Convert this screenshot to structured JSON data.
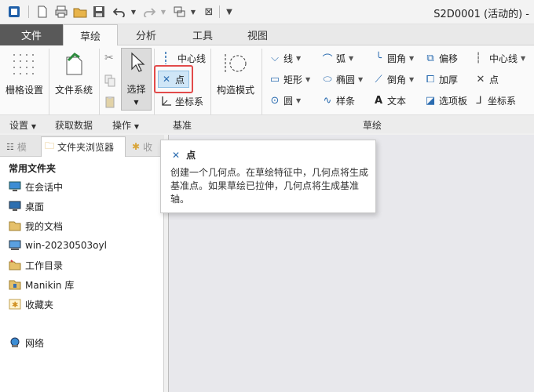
{
  "titlebar": {
    "title": "S2D0001 (活动的) -",
    "quick_access_icons": [
      "app-icon",
      "new-icon",
      "print-icon",
      "open-icon",
      "save-icon",
      "undo-icon",
      "redo-icon",
      "regenerate-icon",
      "close-window-icon",
      "customize-icon"
    ]
  },
  "tabs": [
    {
      "label": "文件"
    },
    {
      "label": "草绘"
    },
    {
      "label": "分析"
    },
    {
      "label": "工具"
    },
    {
      "label": "视图"
    }
  ],
  "ribbon": {
    "grid_settings": "栅格设置",
    "file_system": "文件系统",
    "select": "选择",
    "construction_mode": "构造模式",
    "datum": {
      "centerline": "中心线",
      "point": "点",
      "coordinate_system": "坐标系"
    },
    "sketch": {
      "line": "线",
      "arc": "弧",
      "fillet": "圆角",
      "offset": "偏移",
      "centerline": "中心线",
      "rectangle": "矩形",
      "ellipse": "椭圆",
      "chamfer": "倒角",
      "thicken": "加厚",
      "point": "点",
      "circle": "圆",
      "spline": "样条",
      "text": "文本",
      "palette": "选项板",
      "coordinate_system": "坐标系"
    },
    "groups": {
      "setup": "设置",
      "get_data": "获取数据",
      "operations": "操作",
      "datum": "基准",
      "sketch": "草绘"
    }
  },
  "left_panel": {
    "tabs": [
      "模型树",
      "文件夹浏览器",
      "收藏夹"
    ],
    "visible_tab_labels": [
      "模",
      "文件夹浏览器",
      "收"
    ],
    "header": "常用文件夹",
    "items": [
      {
        "label": "在会话中",
        "icon": "monitor-icon"
      },
      {
        "label": "桌面",
        "icon": "desktop-icon"
      },
      {
        "label": "我的文档",
        "icon": "documents-icon"
      },
      {
        "label": "win-20230503oyl",
        "icon": "computer-icon"
      },
      {
        "label": "工作目录",
        "icon": "working-directory-icon"
      },
      {
        "label": "Manikin 库",
        "icon": "library-icon"
      },
      {
        "label": "收藏夹",
        "icon": "favorites-icon"
      },
      {
        "label": "网络",
        "icon": "network-icon"
      }
    ]
  },
  "tooltip": {
    "title": "点",
    "body": "创建一个几何点。在草绘特征中，几何点将生成基准点。如果草绘已拉伸，几何点将生成基准轴。"
  },
  "colors": {
    "accent": "#2b6cb0",
    "highlight": "#e24a4a",
    "file_tab": "#595959"
  }
}
